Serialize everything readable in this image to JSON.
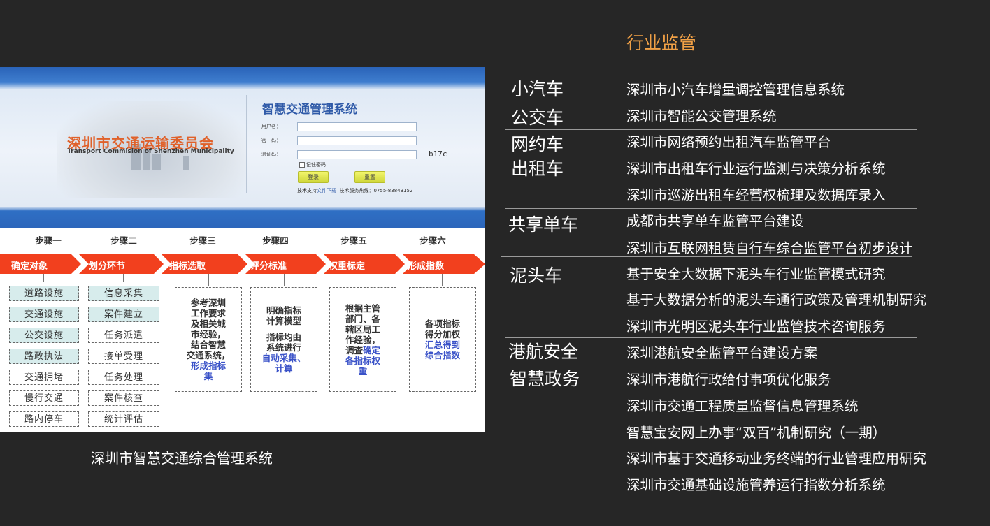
{
  "left_panel": {
    "org_name_cn": "深圳市交通运输委员会",
    "org_name_en": "Transport Commision of Shenzhen Municipality",
    "system_title": "智慧交通管理系统",
    "username_label": "用户名：",
    "password_label": "密　码：",
    "captcha_label": "验证码：",
    "captcha_code": "b17c",
    "remember_label": "记住密码",
    "login_button": "登录",
    "reset_button": "重置",
    "support_prefix": "技术支持",
    "support_link": "文件下载",
    "support_hotline": "技术服务热线：0755-83843152",
    "steps": [
      {
        "title": "步骤一",
        "action": "确定对象"
      },
      {
        "title": "步骤二",
        "action": "划分环节"
      },
      {
        "title": "步骤三",
        "action": "指标选取"
      },
      {
        "title": "步骤四",
        "action": "评分标准"
      },
      {
        "title": "步骤五",
        "action": "权重标定"
      },
      {
        "title": "步骤六",
        "action": "形成指数"
      }
    ],
    "objects": [
      "道路设施",
      "交通设施",
      "公交设施",
      "路政执法",
      "交通拥堵",
      "慢行交通",
      "路内停车"
    ],
    "links": [
      "信息采集",
      "案件建立",
      "任务派遣",
      "接单受理",
      "任务处理",
      "案件核查",
      "统计评估"
    ],
    "desc3": {
      "black": [
        "参考深圳",
        "工作要求",
        "及相关城",
        "市经验，",
        "结合智慧",
        "交通系统，"
      ],
      "blue": [
        "形成指标",
        "集"
      ]
    },
    "desc4": {
      "black1": [
        "明确指标",
        "计算模型"
      ],
      "black2": [
        "指标均由",
        "系统进行"
      ],
      "blue": [
        "自动采集、",
        "计算"
      ]
    },
    "desc5": {
      "black": [
        "根据主管",
        "部门、各",
        "辖区局工",
        "作经验，",
        "调查"
      ],
      "blue_inline": "确定",
      "blue": [
        "各指标权",
        "重"
      ]
    },
    "desc6": {
      "black": [
        "各项指标",
        "得分加权"
      ],
      "blue": [
        "汇总得到",
        "综合指数"
      ]
    },
    "caption": "深圳市智慧交通综合管理系统"
  },
  "right_panel": {
    "title": "行业监管",
    "categories": [
      {
        "name": "小汽车",
        "items": [
          "深圳市小汽车增量调控管理信息系统"
        ]
      },
      {
        "name": "公交车",
        "items": [
          "深圳市智能公交管理系统"
        ]
      },
      {
        "name": "网约车",
        "items": [
          "深圳市网络预约出租汽车监管平台"
        ]
      },
      {
        "name": "出租车",
        "items": [
          "深圳市出租车行业运行监测与决策分析系统",
          "深圳市巡游出租车经营权梳理及数据库录入"
        ]
      },
      {
        "name": "共享单车",
        "items": [
          "成都市共享单车监管平台建设",
          "深圳市互联网租赁自行车综合监管平台初步设计"
        ]
      },
      {
        "name": "泥头车",
        "items": [
          "基于安全大数据下泥头车行业监管模式研究",
          "基于大数据分析的泥头车通行政策及管理机制研究",
          "深圳市光明区泥头车行业监管技术咨询服务"
        ]
      },
      {
        "name": "港航安全",
        "items": [
          "深圳港航安全监管平台建设方案"
        ]
      },
      {
        "name": "智慧政务",
        "items": [
          "深圳市港航行政给付事项优化服务",
          "深圳市交通工程质量监督信息管理系统",
          "智慧宝安网上办事“双百”机制研究（一期）",
          "深圳市基于交通移动业务终端的行业管理应用研究",
          "深圳市交通基础设施管养运行指数分析系统"
        ]
      }
    ]
  }
}
